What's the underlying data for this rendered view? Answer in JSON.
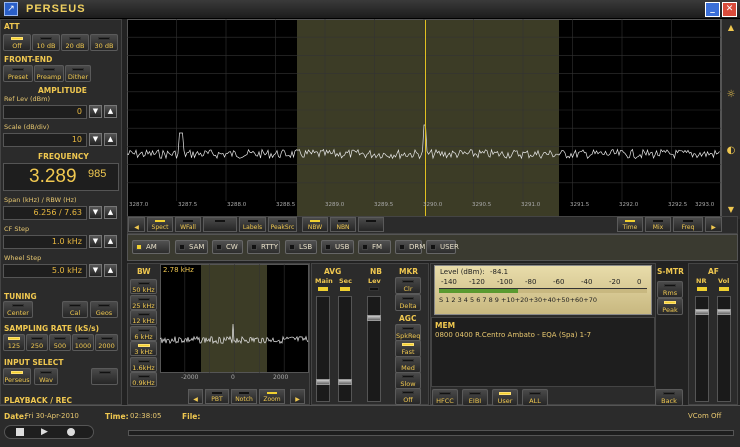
{
  "app": {
    "title": "PERSEUS",
    "icon": "perseus-app-icon"
  },
  "window": {
    "minimize_icon": "minimize-icon",
    "close_icon": "close-icon"
  },
  "att": {
    "label": "ATT",
    "buttons": [
      "Off",
      "10 dB",
      "20 dB",
      "30 dB"
    ],
    "selected": "Off"
  },
  "frontend": {
    "label": "FRONT-END",
    "buttons": [
      "Preset",
      "Preamp",
      "Dither"
    ]
  },
  "amplitude": {
    "label": "AMPLITUDE",
    "ref_label": "Ref Lev (dBm)",
    "ref_value": "0",
    "scale_label": "Scale (dB/div)",
    "scale_value": "10"
  },
  "frequency": {
    "label": "FREQUENCY",
    "main": "3.289",
    "sub": "985",
    "span_label": "Span (kHz) / RBW (Hz)",
    "span_value": "6.256 / 7.63",
    "cf_label": "CF Step",
    "cf_value": "1.0 kHz",
    "wheel_label": "Wheel Step",
    "wheel_value": "5.0 kHz"
  },
  "tuning": {
    "label": "TUNING",
    "buttons": [
      "Center",
      "Cal",
      "Geos"
    ]
  },
  "sampling": {
    "label": "SAMPLING RATE (kS/s)",
    "buttons": [
      "125",
      "250",
      "500",
      "1000",
      "2000"
    ],
    "selected": "125"
  },
  "input": {
    "label": "INPUT SELECT",
    "buttons": [
      "Perseus",
      "Wav",
      ""
    ]
  },
  "playback": {
    "label": "PLAYBACK / REC"
  },
  "spectrum": {
    "ticks": [
      "3287.0",
      "3287.5",
      "3288.0",
      "3288.5",
      "3289.0",
      "3289.5",
      "3290.0",
      "3290.5",
      "3291.0",
      "3291.5",
      "3292.0",
      "3292.5",
      "3293.0"
    ],
    "toolbar_left": [
      "Spect",
      "WFall",
      "",
      "Labels",
      "PeakSrc",
      "NBW",
      "NBN",
      ""
    ],
    "toolbar_right": [
      "Time",
      "Mix",
      "Freq"
    ],
    "right_icons": [
      "scroll-up-icon",
      "brightness-icon",
      "contrast-icon",
      "scroll-down-icon"
    ]
  },
  "modes": [
    {
      "label": "AM",
      "active": true
    },
    {
      "label": "SAM",
      "active": false
    },
    {
      "label": "CW",
      "active": false
    },
    {
      "label": "RTTY",
      "active": false
    },
    {
      "label": "LSB",
      "active": false
    },
    {
      "label": "USB",
      "active": false
    },
    {
      "label": "FM",
      "active": false
    },
    {
      "label": "DRM",
      "active": false
    },
    {
      "label": "USER",
      "active": false
    }
  ],
  "bw": {
    "label": "BW",
    "value_display": "2.78 kHz",
    "buttons": [
      "50 kHz",
      "25 kHz",
      "12 kHz",
      "6 kHz",
      "3 kHz",
      "1.6kHz",
      "0.9kHz"
    ],
    "ticks": [
      "-2000",
      "0",
      "2000"
    ],
    "toolbar": [
      "",
      "PBT",
      "Notch",
      "Zoom",
      ""
    ]
  },
  "avg": {
    "label": "AVG",
    "main": "Main",
    "sec": "Sec"
  },
  "nb": {
    "label": "NB",
    "lev": "Lev"
  },
  "mkr": {
    "label": "MKR",
    "buttons": [
      "Clr",
      "Delta"
    ]
  },
  "agc": {
    "label": "AGC",
    "buttons": [
      "SpkReq",
      "Fast",
      "Med",
      "Slow",
      "Off"
    ]
  },
  "smeter": {
    "label": "S-MTR",
    "buttons": [
      "Rms",
      "Peak"
    ],
    "level_label": "Level (dBm):",
    "level_value": "-84.1",
    "scale_top": [
      "-140",
      "-120",
      "-100",
      "-80",
      "-60",
      "-40",
      "-20",
      "0"
    ],
    "scale_bottom": "S 1 2 3 4 5 6 7 8 9 +10+20+30+40+50+60+70",
    "fill_fraction": 0.38
  },
  "af": {
    "label": "AF",
    "nr": "NR",
    "vol": "Vol"
  },
  "mem": {
    "label": "MEM",
    "entry": "0800 0400 R.Centro Ambato  - EQA (Spa)   1-7",
    "buttons": [
      "HFCC",
      "EIBI",
      "User",
      "ALL"
    ],
    "back": "Back"
  },
  "status": {
    "date_label": "Date:",
    "date": "Fri 30-Apr-2010",
    "time_label": "Time:",
    "time": "02:38:05",
    "file_label": "File:",
    "vcom": "VCom Off"
  },
  "colors": {
    "accent": "#f0c850",
    "band": "#3c3c26",
    "cursor": "#e0c020",
    "meter_fill": "#5a9a30"
  }
}
